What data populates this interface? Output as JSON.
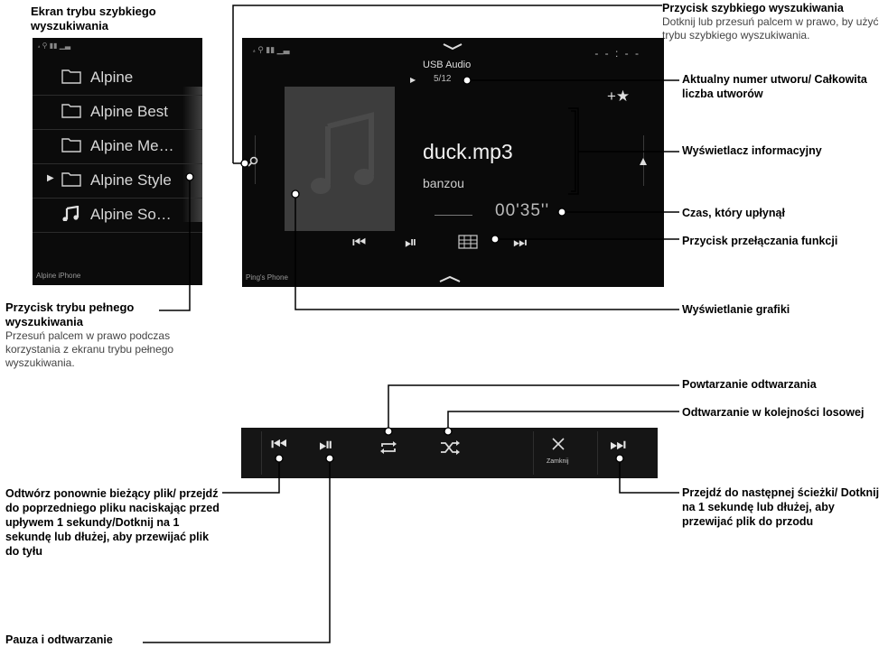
{
  "quick_search": {
    "status": "ﮦ ⚲ ▮▮ ▁▃",
    "items": [
      {
        "label": "Alpine",
        "icon": "folder-icon"
      },
      {
        "label": "Alpine Best",
        "icon": "folder-icon"
      },
      {
        "label": "Alpine Me…",
        "icon": "folder-icon"
      },
      {
        "label": "Alpine Style",
        "icon": "folder-icon",
        "selected": true
      },
      {
        "label": "Alpine So…",
        "icon": "music-note-icon"
      }
    ],
    "footer": "Alpine iPhone"
  },
  "player": {
    "source": "USB Audio",
    "track": "5/12",
    "clock": "- - : - -",
    "title": "duck.mp3",
    "artist": "banzou",
    "elapsed": "00'35''",
    "footer": "Ping's Phone",
    "icons": [
      "chevron-down-icon",
      "search-icon",
      "favorite-add-icon",
      "scroll-up-icon",
      "previous-icon",
      "play-pause-icon",
      "function-switch-icon",
      "next-icon",
      "chevron-up-icon",
      "album-art-icon"
    ]
  },
  "bottom_bar": {
    "close_label": "Zamknij",
    "icons": [
      "previous-icon",
      "play-pause-icon",
      "repeat-icon",
      "shuffle-icon",
      "close-icon",
      "next-icon"
    ]
  },
  "annotations": {
    "quick_search_screen_title": "Ekran trybu szybkiego wyszukiwania",
    "quick_search_button_title": "Przycisk szybkiego wyszukiwania",
    "quick_search_button_desc": "Dotknij lub przesuń palcem w prawo, by użyć trybu szybkiego wyszukiwania.",
    "track_number": "Aktualny numer utworu/ Całkowita liczba utworów",
    "info_display": "Wyświetlacz informacyjny",
    "elapsed_time": "Czas, który upłynął",
    "function_switch": "Przycisk przełączania funkcji",
    "graphics_display": "Wyświetlanie grafiki",
    "full_search_title": "Przycisk trybu pełnego wyszukiwania",
    "full_search_desc": "Przesuń palcem w prawo podczas korzystania z ekranu trybu pełnego wyszukiwania.",
    "repeat": "Powtarzanie odtwarzania",
    "shuffle": "Odtwarzanie w kolejności losowej",
    "previous": "Odtwórz ponownie bieżący plik/ przejdź do poprzedniego pliku naciskając przed upływem 1 sekundy/Dotknij na 1 sekundę lub dłużej, aby przewijać plik do tyłu",
    "next": "Przejdź do następnej ścieżki/ Dotknij na 1 sekundę lub dłużej, aby przewijać plik do przodu",
    "pause_play": "Pauza i odtwarzanie"
  }
}
